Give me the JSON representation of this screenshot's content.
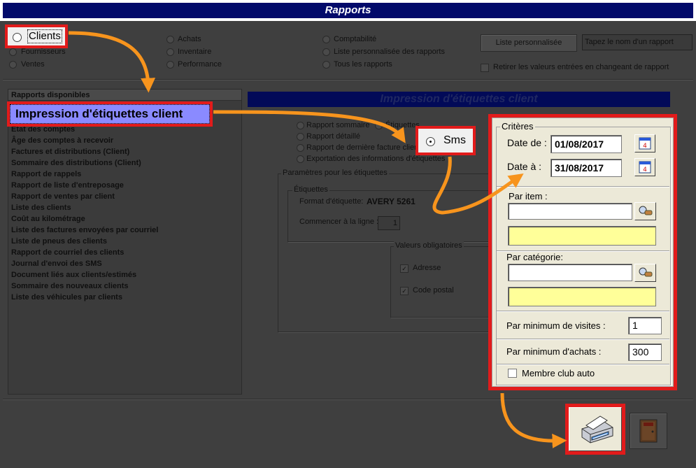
{
  "window": {
    "title": "Rapports"
  },
  "top": {
    "radios_col1": [
      "Clients",
      "Fournisseurs",
      "Ventes"
    ],
    "radios_col2": [
      "Achats",
      "Inventaire",
      "Performance"
    ],
    "radios_col3": [
      "Comptabilité",
      "Liste personnalisée des rapports",
      "Tous les rapports"
    ],
    "custom_list_button": "Liste personnalisée",
    "report_name_placeholder": "Tapez le nom d'un rapport",
    "retain_values_label": "Retirer les valeurs entrées en changeant de rapport"
  },
  "report_list": {
    "header": "Rapports disponibles",
    "items": [
      "État des comptes",
      "Âge des comptes à recevoir",
      "Factures et distributions (Client)",
      "Sommaire des distributions (Client)",
      "Rapport de rappels",
      "Rapport de liste d'entreposage",
      "Rapport de ventes par client",
      "Liste des clients",
      "Coût au kilométrage",
      "Liste des factures envoyées par courriel",
      "Liste de pneus des clients",
      "Rapport de courriel des clients",
      "Journal d'envoi des SMS",
      "Document liés aux clients/estimés",
      "Sommaire des nouveaux clients",
      "Liste des véhicules par clients"
    ]
  },
  "panel": {
    "title": "Impression d'étiquettes client",
    "format_radios": [
      "Rapport sommaire",
      "Rapport détaillé",
      "Rapport de dernière facture client",
      "Exportation des informations d'étiquettes"
    ],
    "etiquettes_radio": "Étiquettes",
    "params_group": "Paramètres pour les étiquettes",
    "labels_group": "Étiquettes",
    "format_label": "Format d'étiquette:",
    "format_value": "AVERY 5261",
    "start_line_label": "Commencer à la ligne :",
    "start_line_value": "1",
    "mandatory_group": "Valeurs obligatoires",
    "mandatory_items": [
      "Adresse",
      "Code postal"
    ]
  },
  "callouts": {
    "clients": "Clients",
    "report_title": "Impression d'étiquettes client",
    "sms": "Sms"
  },
  "criteria": {
    "title": "Critères",
    "date_from_label": "Date de :",
    "date_from": "01/08/2017",
    "date_to_label": "Date à :",
    "date_to": "31/08/2017",
    "by_item_label": "Par item :",
    "by_item_value": "",
    "by_category_label": "Par catégorie:",
    "by_category_value": "",
    "min_visits_label": "Par minimum de visites :",
    "min_visits": "1",
    "min_purchases_label": "Par minimum d'achats :",
    "min_purchases": "300",
    "club_label": "Membre club auto"
  },
  "colors": {
    "arrow": "#f7941d",
    "callout_border": "#e21b1b",
    "title_bar": "#020a6a",
    "highlight": "#8a8aff",
    "yellow_field": "#ffff99"
  },
  "icons": [
    "calendar-icon",
    "search-icon",
    "printer-icon",
    "exit-door-icon"
  ]
}
